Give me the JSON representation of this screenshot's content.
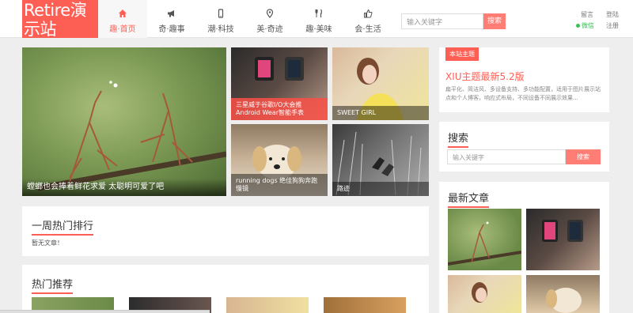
{
  "header": {
    "logo": "Retire演示站",
    "nav": [
      {
        "label": "趣·首页",
        "icon": "home-icon",
        "active": true
      },
      {
        "label": "奇·趣事",
        "icon": "megaphone-icon",
        "active": false
      },
      {
        "label": "潮·科技",
        "icon": "phone-icon",
        "active": false
      },
      {
        "label": "美·奇迹",
        "icon": "location-pin-icon",
        "active": false
      },
      {
        "label": "趣·美味",
        "icon": "fork-knife-icon",
        "active": false
      },
      {
        "label": "会·生活",
        "icon": "thumbs-up-icon",
        "active": false
      }
    ],
    "search_placeholder": "输入关键字",
    "search_button": "搜索",
    "links": {
      "message": "留言",
      "login": "登陆",
      "weixin": "微信",
      "register": "注册"
    }
  },
  "featured": {
    "big_caption": "螳螂也会捧着鲜花求爱 太聪明可爱了吧",
    "tiles": [
      {
        "caption": "三星威于谷歌I/O大会推Android Wear智能手表"
      },
      {
        "caption": "SWEET GIRL"
      },
      {
        "caption": "running dogs 绝佳狗狗奔跑慢镜"
      },
      {
        "caption": "路迹"
      }
    ]
  },
  "weekly_hot": {
    "title": "一周热门排行",
    "empty": "暂无文章！"
  },
  "hot_recommend": {
    "title": "热门推荐"
  },
  "sidebar": {
    "site_topic": {
      "badge": "本站主题",
      "title": "XIU主题最新5.2版",
      "desc": "扁平化、简洁风、多设备支持、多功能配置，适用于图片展示站点和个人博客，响应式布局，不同设备不同展示效果..."
    },
    "search": {
      "title": "搜索",
      "placeholder": "输入关键字",
      "button": "搜索"
    },
    "latest": {
      "title": "最新文章"
    }
  },
  "colors": {
    "accent": "#fe5f55",
    "button": "#fe7d75",
    "weixin": "#3bbf56"
  }
}
